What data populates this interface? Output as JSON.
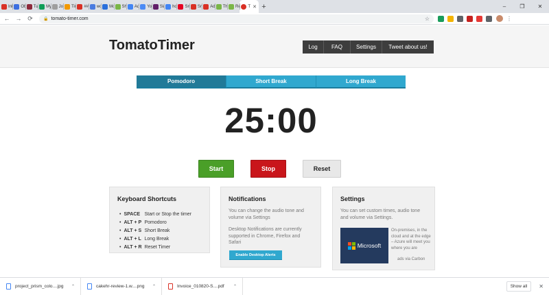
{
  "browser": {
    "tabs": [
      {
        "label": "Inbo",
        "color": "#d93025",
        "glyph": "M"
      },
      {
        "label": "Obli",
        "color": "#3c6ee0",
        "glyph": "GR"
      },
      {
        "label": "Tum",
        "color": "#8e2a3b",
        "glyph": ""
      },
      {
        "label": "My c",
        "color": "#0f9d58",
        "glyph": "+"
      },
      {
        "label": "Joe",
        "color": "#9e9e9e",
        "glyph": ""
      },
      {
        "label": "Tim",
        "color": "#f29900",
        "glyph": ""
      },
      {
        "label": "## T",
        "color": "#d93025",
        "glyph": ""
      },
      {
        "label": "worl",
        "color": "#4a7be0",
        "glyph": ""
      },
      {
        "label": "Moli",
        "color": "#2a6fdb",
        "glyph": ""
      },
      {
        "label": "Sho",
        "color": "#7ab648",
        "glyph": ""
      },
      {
        "label": "Ads",
        "color": "#4285f4",
        "glyph": ""
      },
      {
        "label": "Your",
        "color": "#4c8bf5",
        "glyph": ""
      },
      {
        "label": "Slac",
        "color": "#611f69",
        "glyph": ""
      },
      {
        "label": "hom",
        "color": "#4285f4",
        "glyph": "G"
      },
      {
        "label": "Smu",
        "color": "#e60023",
        "glyph": ""
      },
      {
        "label": "Smu",
        "color": "#d93025",
        "glyph": ""
      },
      {
        "label": "Adri",
        "color": "#d93025",
        "glyph": ""
      },
      {
        "label": "The",
        "color": "#7ab648",
        "glyph": ""
      },
      {
        "label": "Rem",
        "color": "#7ab648",
        "glyph": ""
      }
    ],
    "active_tab": {
      "label": "T",
      "color": "#d93025"
    },
    "new_tab": "+",
    "window_controls": [
      "–",
      "❐",
      "✕"
    ],
    "url": "tomato-timer.com",
    "extensions": [
      "#1a9c5b",
      "#f4b400",
      "#5f6368",
      "#c5221f",
      "#e53935",
      "#5f6368"
    ]
  },
  "site": {
    "logo": "TomatoTimer",
    "nav": [
      {
        "label": "Log",
        "width": 31
      },
      {
        "label": "FAQ",
        "width": 39
      },
      {
        "label": "Settings",
        "width": 46
      },
      {
        "label": "Tweet about us!",
        "width": 75
      }
    ],
    "modes": [
      {
        "label": "Pomodoro",
        "active": true
      },
      {
        "label": "Short Break",
        "active": false
      },
      {
        "label": "Long Break",
        "active": false
      }
    ],
    "timer": "25:00",
    "controls": {
      "start": "Start",
      "stop": "Stop",
      "reset": "Reset"
    },
    "cards": {
      "shortcuts": {
        "title": "Keyboard Shortcuts",
        "items": [
          {
            "key": "SPACE",
            "action": "Start or Stop the timer"
          },
          {
            "key": "ALT + P",
            "action": "Pomodoro"
          },
          {
            "key": "ALT + S",
            "action": "Short Break"
          },
          {
            "key": "ALT + L",
            "action": "Long Break"
          },
          {
            "key": "ALT + R",
            "action": "Reset Timer"
          }
        ]
      },
      "notifications": {
        "title": "Notifications",
        "text1": "You can change the audio tone and volume via Settings",
        "text2": "Desktop Notifications are currently supported in Chrome, Firefox and Safari",
        "button": "Enable Desktop Alerts"
      },
      "settings": {
        "title": "Settings",
        "text": "You can set custom times, audio tone and volume via Settings.",
        "ad": {
          "brand": "Microsoft",
          "text": "On-premises, in the cloud and at the edge – Azure will meet you where you are",
          "by": "ads via Carbon"
        }
      }
    }
  },
  "downloads": {
    "items": [
      {
        "name": "project_prism_colo....jpg",
        "type": "img"
      },
      {
        "name": "cakehr-review-1.w....png",
        "type": "img"
      },
      {
        "name": "Invoice_010820-S....pdf",
        "type": "pdf"
      }
    ],
    "show_all": "Show all",
    "close": "✕"
  }
}
